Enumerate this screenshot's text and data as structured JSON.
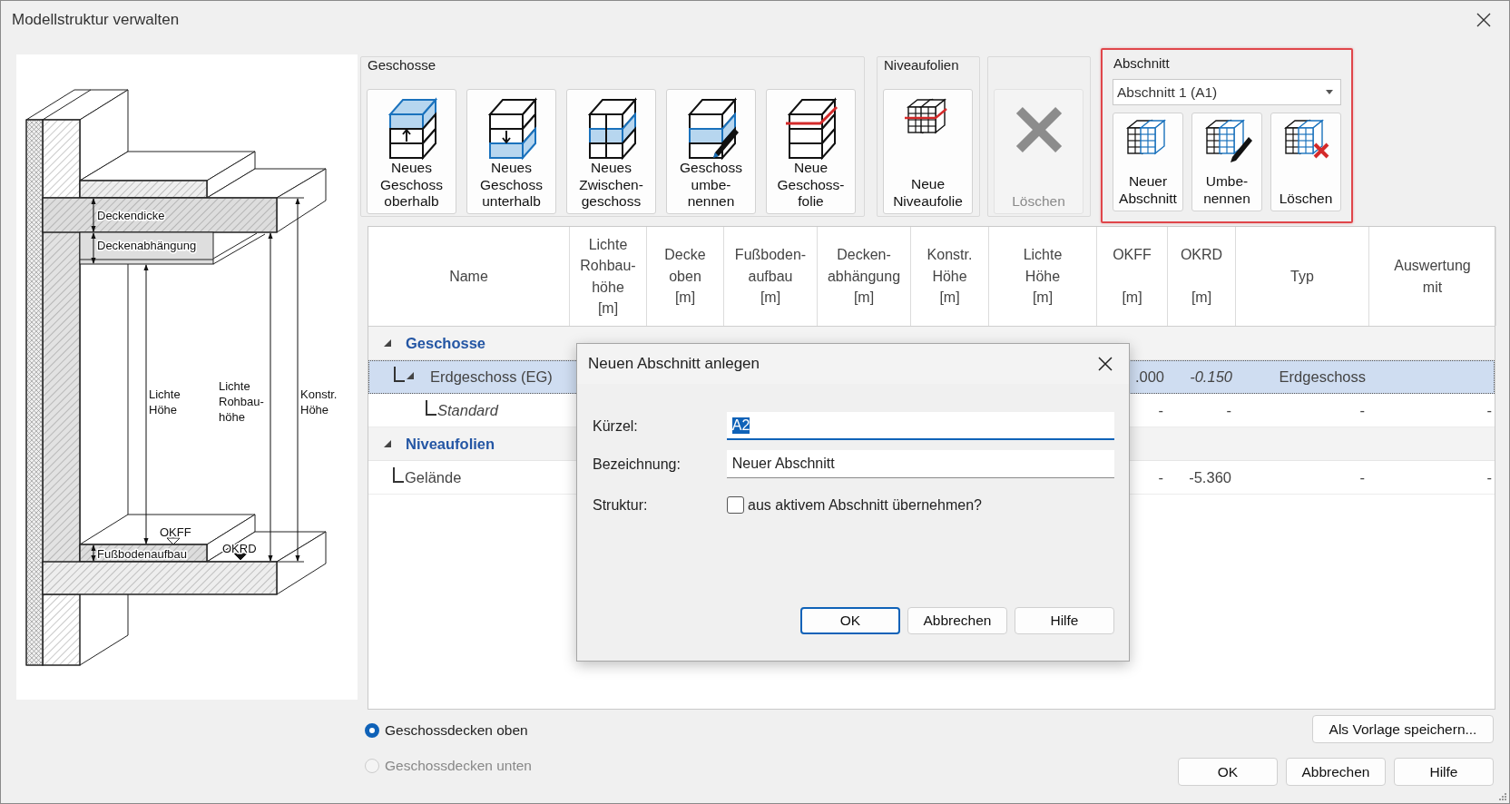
{
  "window": {
    "title": "Modellstruktur verwalten"
  },
  "diagram": {
    "labels": [
      {
        "lines": [
          "Deckendicke"
        ]
      },
      {
        "lines": [
          "Deckenabhängung"
        ]
      },
      {
        "lines": [
          "Lichte",
          "Höhe"
        ]
      },
      {
        "lines": [
          "Lichte",
          "Rohbau-",
          "höhe"
        ]
      },
      {
        "lines": [
          "Konstr.",
          "Höhe"
        ]
      },
      {
        "lines": [
          "OKFF"
        ]
      },
      {
        "lines": [
          "OKRD"
        ]
      },
      {
        "lines": [
          "Fußbodenaufbau"
        ]
      }
    ]
  },
  "toolbar": {
    "groups": [
      {
        "title": "Geschosse",
        "buttons": [
          {
            "kind": "new-above",
            "label": "Neues\nGeschoss\noberhalb",
            "disabled": false
          },
          {
            "kind": "new-below",
            "label": "Neues\nGeschoss\nunterhalb",
            "disabled": false
          },
          {
            "kind": "intermediate",
            "label": "Neues\nZwischen-\ngeschoss",
            "disabled": false
          },
          {
            "kind": "rename",
            "label": "Geschoss\numbe-\nnennen",
            "disabled": false
          },
          {
            "kind": "foil",
            "label": "Neue\nGeschoss-\nfolie",
            "disabled": false
          }
        ]
      },
      {
        "title": "Niveaufolien",
        "buttons": [
          {
            "kind": "new-level-foil",
            "label": "Neue\nNiveaufolie",
            "disabled": false
          }
        ]
      },
      {
        "buttons": [
          {
            "kind": "delete",
            "label": "Löschen",
            "disabled": true
          }
        ]
      }
    ]
  },
  "section": {
    "title": "Abschnitt",
    "highlighted": true,
    "dropdown": {
      "value": "Abschnitt 1 (A1)"
    },
    "buttons": [
      {
        "kind": "new-section",
        "label": "Neuer\nAbschnitt"
      },
      {
        "kind": "rename-section",
        "label": "Umbe-\nnennen"
      },
      {
        "kind": "delete-section",
        "label": "Löschen"
      }
    ]
  },
  "table": {
    "columns": [
      {
        "label": "Name"
      },
      {
        "label": "Lichte\nRohbau-\nhöhe\n[m]"
      },
      {
        "label": "Decke\noben\n[m]"
      },
      {
        "label": "Fußboden-\naufbau\n[m]"
      },
      {
        "label": "Decken-\nabhängung\n[m]"
      },
      {
        "label": "Konstr.\nHöhe\n[m]"
      },
      {
        "label": "Lichte\nHöhe\n[m]"
      },
      {
        "label": "OKFF\n\n[m]"
      },
      {
        "label": "OKRD\n\n[m]"
      },
      {
        "label": "Typ"
      },
      {
        "label": "Auswertung\nmit"
      }
    ],
    "rows": [
      {
        "label": "Geschosse",
        "expanded": true,
        "children": [
          {
            "label": "Erdgeschoss (EG)",
            "italic": false,
            "selected": true,
            "expanded": true,
            "cells": [
              {
                "text": ".000",
                "italic": false
              },
              {
                "text": "-0.150",
                "italic": true
              },
              {
                "text": "Erdgeschoss",
                "italic": false
              }
            ],
            "children": [
              {
                "label": "Standard",
                "italic": true,
                "selected": false,
                "cells": [
                  {
                    "text": "-",
                    "italic": false
                  },
                  {
                    "text": "-",
                    "italic": false
                  },
                  {
                    "text": "-",
                    "italic": false
                  },
                  {
                    "text": "-",
                    "italic": false
                  }
                ]
              }
            ]
          }
        ]
      },
      {
        "label": "Niveaufolien",
        "expanded": true,
        "children": [
          {
            "label": "Gelände",
            "italic": false,
            "selected": false,
            "cells": [
              {
                "text": "-",
                "italic": false
              },
              {
                "text": "-5.360",
                "italic": false
              },
              {
                "text": "-",
                "italic": false
              },
              {
                "text": "-",
                "italic": false
              }
            ]
          }
        ]
      }
    ]
  },
  "ceiling_position": [
    {
      "label": "Geschossdecken oben",
      "selected": true,
      "disabled": false
    },
    {
      "label": "Geschossdecken unten",
      "selected": false,
      "disabled": true
    }
  ],
  "template_button": "Als Vorlage speichern...",
  "buttons": [
    {
      "label": "OK"
    },
    {
      "label": "Abbrechen"
    },
    {
      "label": "Hilfe"
    }
  ],
  "dialog": {
    "title": "Neuen Abschnitt anlegen",
    "fields": [
      {
        "label": "Kürzel:",
        "value": "A2",
        "focused": true
      },
      {
        "label": "Bezeichnung:",
        "value": "Neuer Abschnitt",
        "focused": false
      }
    ],
    "option": {
      "label": "Struktur:",
      "checkbox": {
        "label": "aus aktivem Abschnitt übernehmen?",
        "checked": false
      }
    },
    "buttons": [
      {
        "label": "OK",
        "default": true
      },
      {
        "label": "Abbrechen",
        "default": false
      },
      {
        "label": "Hilfe",
        "default": false
      }
    ]
  }
}
